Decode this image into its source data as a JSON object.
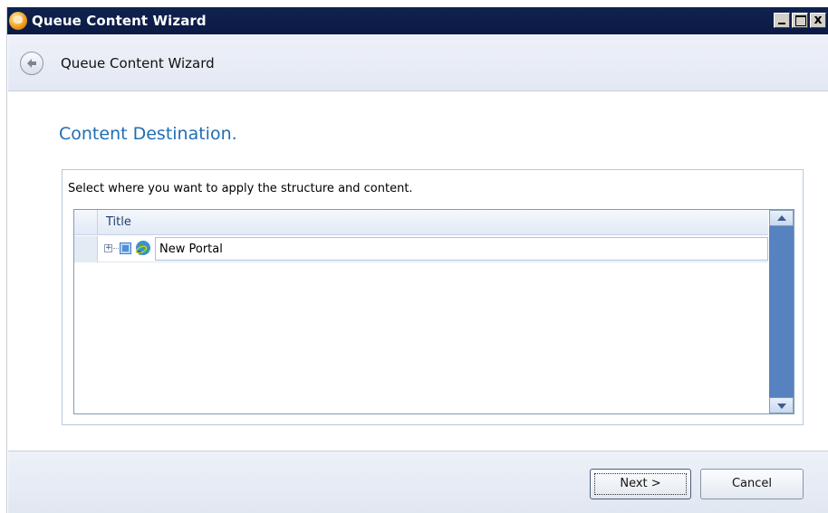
{
  "window": {
    "title": "Queue Content Wizard",
    "controls": {
      "minimize": "_",
      "maximize": "□",
      "close": "x"
    }
  },
  "nav": {
    "back_icon": "back-arrow-icon",
    "title": "Queue Content Wizard"
  },
  "page": {
    "heading": "Content Destination.",
    "instruction": "Select where you want to apply the structure and content."
  },
  "grid": {
    "columns": [
      "Title"
    ],
    "rows": [
      {
        "title": "New Portal",
        "expander": "+",
        "icon": "globe-icon",
        "checkbox_state": "partial"
      }
    ]
  },
  "footer": {
    "next_label": "Next >",
    "cancel_label": "Cancel"
  },
  "colors": {
    "titlebar": "#0a1a44",
    "heading": "#1f6eb3",
    "scrollbar_track": "#5682bf"
  }
}
